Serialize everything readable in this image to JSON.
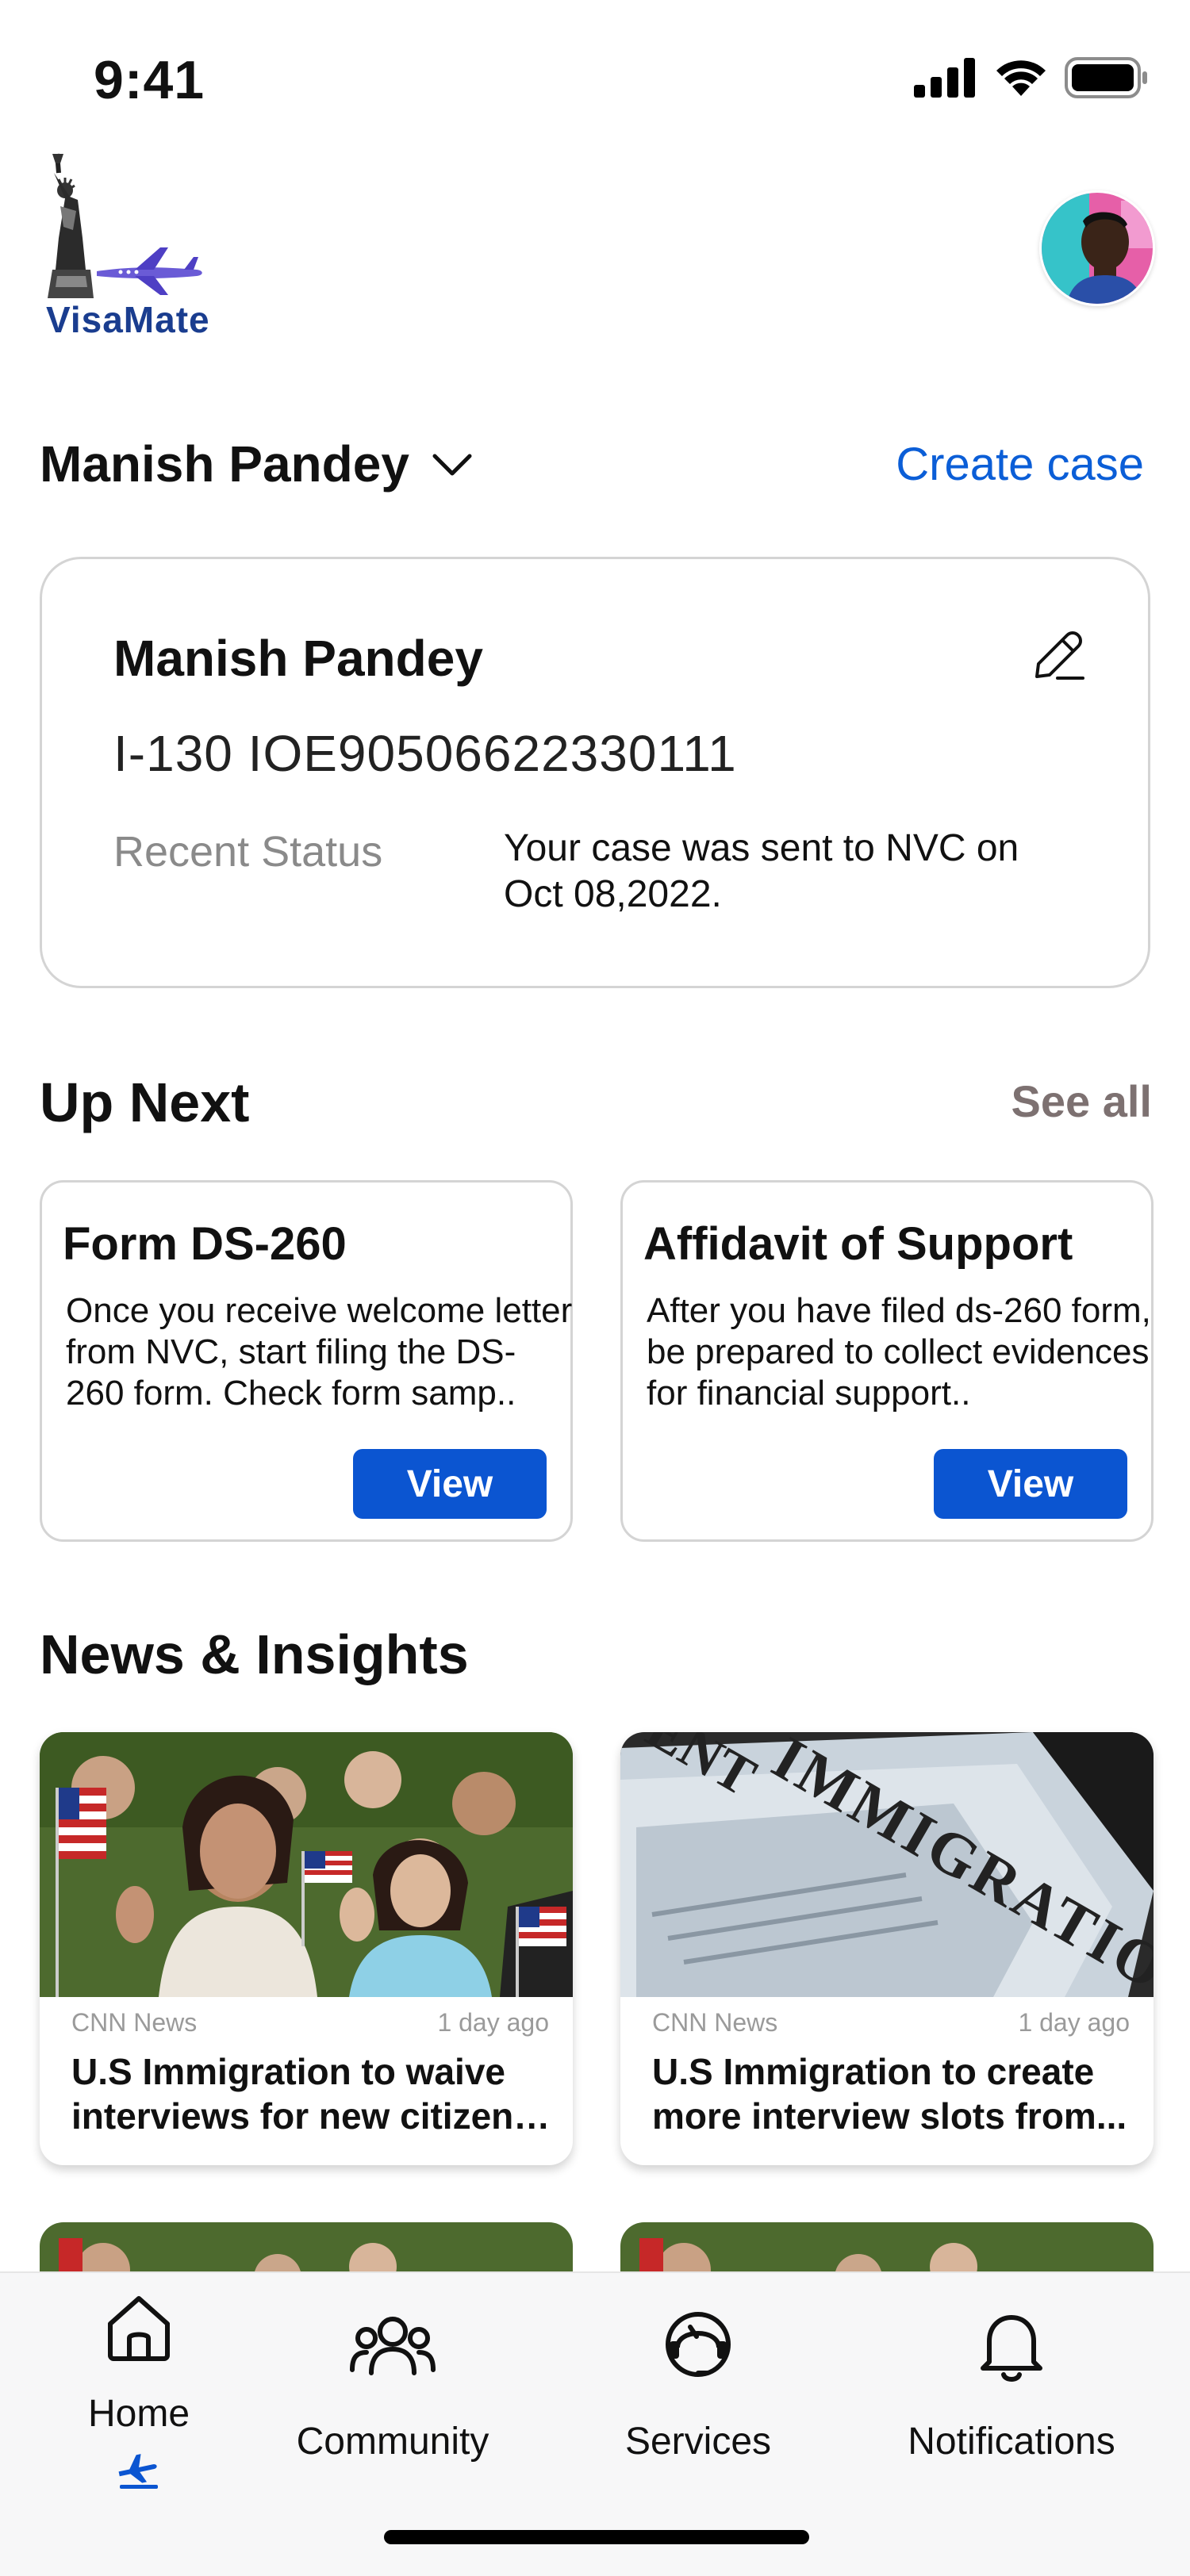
{
  "status_bar": {
    "time": "9:41"
  },
  "header": {
    "logo_text": "VisaMate",
    "avatar": "user-avatar"
  },
  "case_selector": {
    "selected_name": "Manish Pandey",
    "create_case_label": "Create case"
  },
  "case_card": {
    "name": "Manish Pandey",
    "case_number": "I-130 IOE90506622330111",
    "recent_status_label": "Recent Status",
    "recent_status_text": "Your case was sent to NVC on\n Oct 08,2022."
  },
  "up_next": {
    "title": "Up Next",
    "see_all_label": "See all",
    "cards": [
      {
        "title": "Form DS-260",
        "description": "Once you receive welcome letter from NVC, start filing the DS-260 form. Check form samp..",
        "button_label": "View"
      },
      {
        "title": "Affidavit of Support",
        "description": "After you have filed ds-260 form, be prepared to collect evidences for financial support..",
        "button_label": "View"
      }
    ]
  },
  "news": {
    "title": "News & Insights",
    "articles": [
      {
        "source": "CNN News",
        "time": "1 day ago",
        "title_line1": "U.S Immigration to waive",
        "title_line2": "interviews for new citizens..."
      },
      {
        "source": "CNN News",
        "time": "1 day ago",
        "title_line1": "U.S Immigration to create",
        "title_line2": "more interview slots from..."
      }
    ]
  },
  "tab_bar": {
    "tabs": [
      {
        "label": "Home",
        "icon": "home-icon",
        "active": true
      },
      {
        "label": "Community",
        "icon": "community-icon",
        "active": false
      },
      {
        "label": "Services",
        "icon": "services-icon",
        "active": false
      },
      {
        "label": "Notifications",
        "icon": "bell-icon",
        "active": false
      }
    ]
  },
  "colors": {
    "accent": "#0b5ed7",
    "button": "#0b55d1",
    "muted": "#8a8a8a",
    "see_all": "#7d7171"
  }
}
